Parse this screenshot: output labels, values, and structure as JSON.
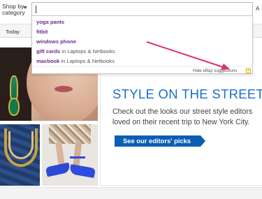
{
  "header": {
    "shop_by_category": "Shop by category",
    "right_edge_char": "A"
  },
  "nav": {
    "today": "Today"
  },
  "search": {
    "value": "",
    "suggestions": [
      {
        "bold": "yoga pants",
        "in": "",
        "category": ""
      },
      {
        "bold": "fitbit",
        "in": "",
        "category": ""
      },
      {
        "bold": "windows phone",
        "in": "",
        "category": ""
      },
      {
        "bold": "gift cards",
        "in": " in ",
        "category": "Laptops & Netbooks"
      },
      {
        "bold": "macbook",
        "in": " in ",
        "category": "Laptops & Netbooks"
      }
    ],
    "hide_suggestions": "Hide eBay suggestions",
    "close_glyph": "x"
  },
  "promo": {
    "title": "STYLE ON THE STREET",
    "body": "Check out the looks our street style editors loved on their recent trip to New York City.",
    "cta": "See our editors' picks"
  },
  "colors": {
    "suggestion_text": "#6a2e8f",
    "promo_title": "#1a6ec9",
    "cta_bg": "#0a5fb4",
    "arrow": "#e0306a"
  }
}
